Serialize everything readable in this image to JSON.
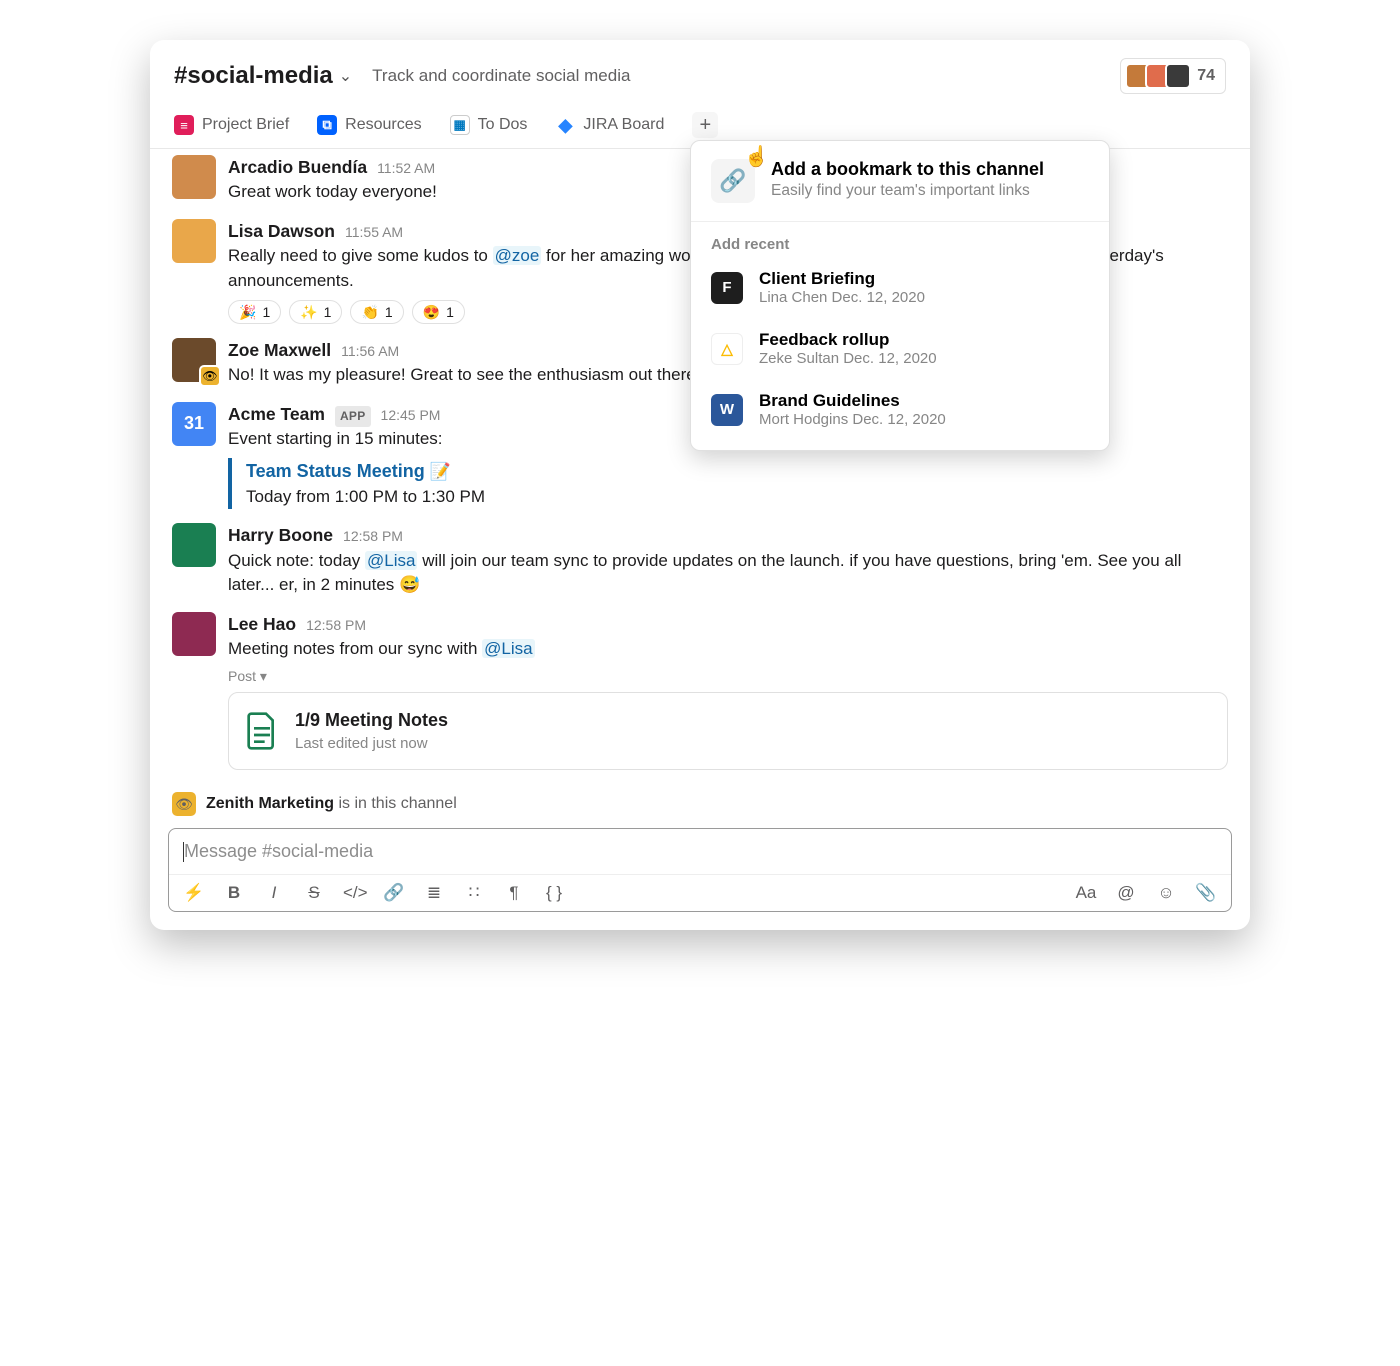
{
  "header": {
    "channel_name": "#social-media",
    "topic": "Track and coordinate social media",
    "member_count": "74"
  },
  "bookmarks": {
    "items": [
      {
        "label": "Project Brief",
        "icon_bg": "#e01e5a",
        "icon_txt": "≡"
      },
      {
        "label": "Resources",
        "icon_bg": "#0061fe",
        "icon_txt": "⧉"
      },
      {
        "label": "To Dos",
        "icon_bg": "#0079bf",
        "icon_txt": "▦"
      },
      {
        "label": "JIRA Board",
        "icon_bg": "#2684ff",
        "icon_txt": "◆"
      }
    ]
  },
  "dropdown": {
    "title": "Add a bookmark to this channel",
    "subtitle": "Easily find your team's important links",
    "section_label": "Add recent",
    "items": [
      {
        "title": "Client Briefing",
        "meta": "Lina Chen Dec. 12, 2020",
        "icon_bg": "#1e1e1e",
        "icon_txt": "F"
      },
      {
        "title": "Feedback rollup",
        "meta": "Zeke Sultan Dec. 12, 2020",
        "icon_bg": "#ffffff",
        "icon_txt": "△"
      },
      {
        "title": "Brand Guidelines",
        "meta": "Mort Hodgins Dec. 12, 2020",
        "icon_bg": "#2b579a",
        "icon_txt": "W"
      }
    ]
  },
  "messages": [
    {
      "author": "Arcadio Buendía",
      "time": "11:52 AM",
      "text": "Great work today everyone!",
      "avatar": "#d08b4c"
    },
    {
      "author": "Lisa Dawson",
      "time": "11:55 AM",
      "text_pre": "Really need to give some kudos to ",
      "mention": "@zoe",
      "text_post": " for her amazing work yesterday. People are really, really excited about yesterday's announcements.",
      "avatar": "#e9a74a",
      "reactions": [
        {
          "emoji": "🎉",
          "count": "1"
        },
        {
          "emoji": "✨",
          "count": "1"
        },
        {
          "emoji": "👏",
          "count": "1"
        },
        {
          "emoji": "😍",
          "count": "1"
        }
      ]
    },
    {
      "author": "Zoe Maxwell",
      "time": "11:56 AM",
      "text": "No! It was my pleasure! Great to see the enthusiasm out there.",
      "avatar": "#6b4a2b",
      "badge": true
    },
    {
      "author": "Acme Team",
      "time": "12:45 PM",
      "app": "APP",
      "text": "Event starting in 15 minutes:",
      "avatar": "#4285f4",
      "avatar_text": "31",
      "event": {
        "title": "Team Status Meeting",
        "emoji": "📝",
        "detail": "Today from 1:00 PM to 1:30 PM"
      }
    },
    {
      "author": "Harry Boone",
      "time": "12:58 PM",
      "text_pre": "Quick note: today ",
      "mention": "@Lisa",
      "text_post": " will join our team sync to provide updates on the launch. if you have questions, bring 'em. See you all later... er, in 2 minutes 😅",
      "avatar": "#1a7f52"
    },
    {
      "author": "Lee Hao",
      "time": "12:58 PM",
      "text_pre": "Meeting notes from our sync with ",
      "mention": "@Lisa",
      "text_post": "",
      "avatar": "#8e2a52",
      "post_label": "Post ▾",
      "attachment": {
        "title": "1/9 Meeting Notes",
        "sub": "Last edited just now"
      }
    }
  ],
  "notice": {
    "name": "Zenith Marketing",
    "text": " is in this channel"
  },
  "composer": {
    "placeholder": "Message #social-media"
  }
}
